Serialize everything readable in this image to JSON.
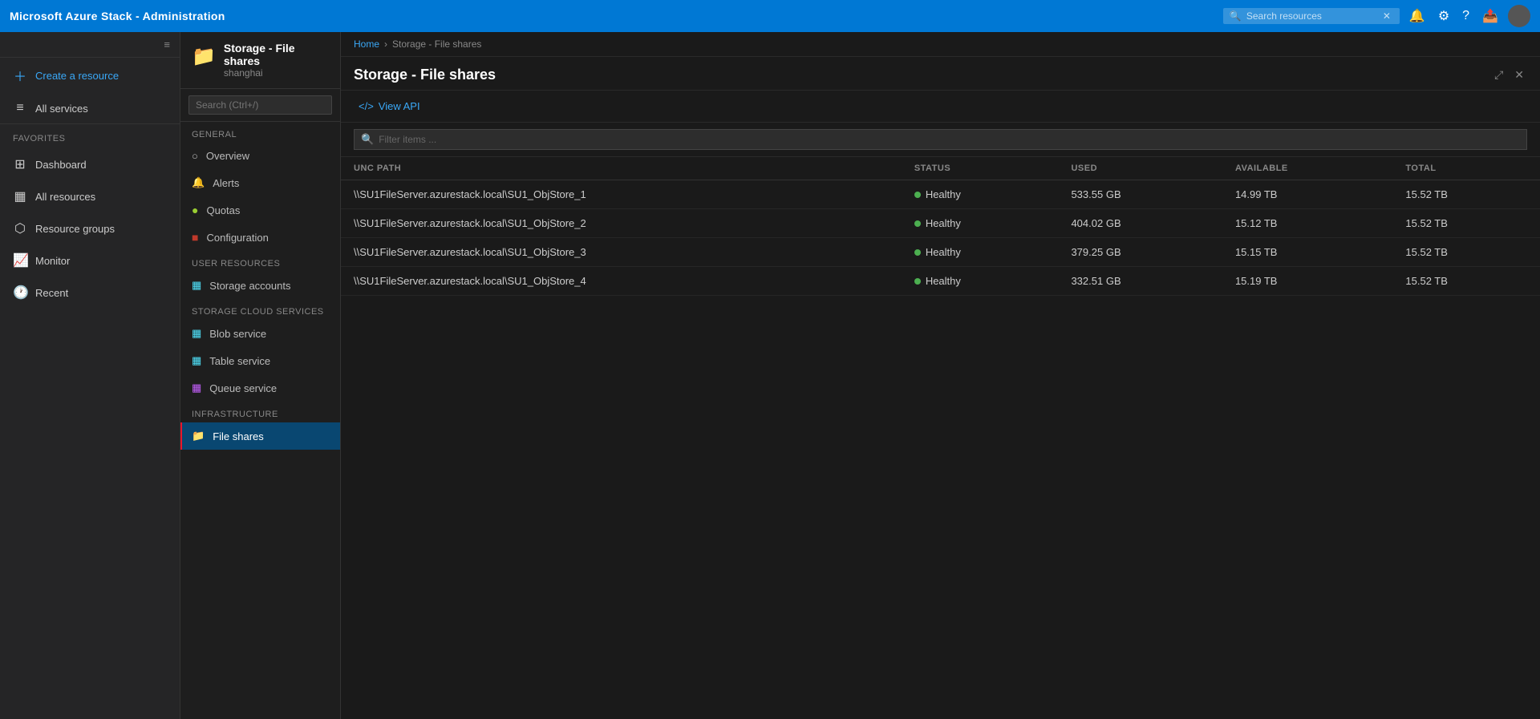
{
  "app": {
    "title": "Microsoft Azure Stack - Administration"
  },
  "topbar": {
    "search_placeholder": "Search resources",
    "search_clear": "✕"
  },
  "sidebar": {
    "create_resource_label": "Create a resource",
    "all_services_label": "All services",
    "favorites_section": "FAVORITES",
    "items": [
      {
        "id": "dashboard",
        "label": "Dashboard",
        "icon": "⊞"
      },
      {
        "id": "all-resources",
        "label": "All resources",
        "icon": "▦"
      },
      {
        "id": "resource-groups",
        "label": "Resource groups",
        "icon": "⬡"
      },
      {
        "id": "monitor",
        "label": "Monitor",
        "icon": "📈"
      },
      {
        "id": "recent",
        "label": "Recent",
        "icon": "🕐"
      }
    ]
  },
  "resource_nav": {
    "title": "Storage - File shares",
    "subtitle": "shanghai",
    "search_placeholder": "Search (Ctrl+/)",
    "general_section": "GENERAL",
    "general_items": [
      {
        "id": "overview",
        "label": "Overview",
        "icon": "○"
      },
      {
        "id": "alerts",
        "label": "Alerts",
        "icon": "🔔"
      },
      {
        "id": "quotas",
        "label": "Quotas",
        "icon": "○"
      },
      {
        "id": "configuration",
        "label": "Configuration",
        "icon": "🔴"
      }
    ],
    "user_resources_section": "USER RESOURCES",
    "user_resources_items": [
      {
        "id": "storage-accounts",
        "label": "Storage accounts",
        "icon": "▦"
      }
    ],
    "storage_cloud_section": "STORAGE CLOUD SERVICES",
    "storage_cloud_items": [
      {
        "id": "blob-service",
        "label": "Blob service",
        "icon": "▦"
      },
      {
        "id": "table-service",
        "label": "Table service",
        "icon": "▦"
      },
      {
        "id": "queue-service",
        "label": "Queue service",
        "icon": "▦"
      }
    ],
    "infrastructure_section": "INFRASTRUCTURE",
    "infrastructure_items": [
      {
        "id": "file-shares",
        "label": "File shares",
        "icon": "📁",
        "active": true
      }
    ]
  },
  "breadcrumb": {
    "home": "Home",
    "current": "Storage - File shares"
  },
  "content": {
    "title": "Storage - File shares",
    "view_api_label": "View API",
    "filter_placeholder": "Filter items ...",
    "columns": [
      {
        "id": "unc-path",
        "label": "UNC PATH"
      },
      {
        "id": "status",
        "label": "STATUS"
      },
      {
        "id": "used",
        "label": "USED"
      },
      {
        "id": "available",
        "label": "AVAILABLE"
      },
      {
        "id": "total",
        "label": "TOTAL"
      }
    ],
    "rows": [
      {
        "unc_path": "\\\\SU1FileServer.azurestack.local\\SU1_ObjStore_1",
        "status": "Healthy",
        "status_type": "healthy",
        "used": "533.55 GB",
        "available": "14.99 TB",
        "total": "15.52 TB"
      },
      {
        "unc_path": "\\\\SU1FileServer.azurestack.local\\SU1_ObjStore_2",
        "status": "Healthy",
        "status_type": "healthy",
        "used": "404.02 GB",
        "available": "15.12 TB",
        "total": "15.52 TB"
      },
      {
        "unc_path": "\\\\SU1FileServer.azurestack.local\\SU1_ObjStore_3",
        "status": "Healthy",
        "status_type": "healthy",
        "used": "379.25 GB",
        "available": "15.15 TB",
        "total": "15.52 TB"
      },
      {
        "unc_path": "\\\\SU1FileServer.azurestack.local\\SU1_ObjStore_4",
        "status": "Healthy",
        "status_type": "healthy",
        "used": "332.51 GB",
        "available": "15.19 TB",
        "total": "15.52 TB"
      }
    ]
  }
}
